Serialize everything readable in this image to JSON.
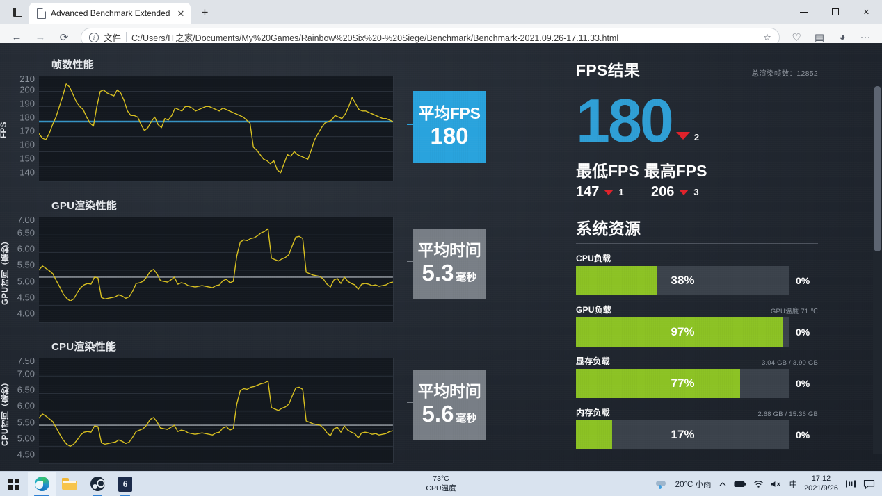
{
  "browser": {
    "tab_title": "Advanced Benchmark Extended",
    "tab_close": "✕",
    "new_tab": "+",
    "back": "←",
    "forward": "→",
    "reload": "⟳",
    "info_glyph": "i",
    "scheme_label": "文件",
    "url": "C:/Users/IT之家/Documents/My%20Games/Rainbow%20Six%20-%20Siege/Benchmark/Benchmark-2021.09.26-17.11.33.html",
    "favorite_star": "☆",
    "favorites_icon": "♡",
    "collections_icon": "▤",
    "profile_icon": "◕",
    "settings_icon": "···",
    "minimize": "—",
    "maximize": "▢",
    "close": "✕"
  },
  "charts": [
    {
      "title": "帧数性能",
      "ylabel": "FPS",
      "badge_top": "平均FPS",
      "badge_top_small": "",
      "badge_value": "180",
      "badge_unit": "",
      "badge_color": "#29a3dd"
    },
    {
      "title": "GPU渲染性能",
      "ylabel": "GPU时间（毫秒）",
      "badge_top": "平均时间",
      "badge_value": "5.3",
      "badge_unit": "毫秒",
      "badge_color": "#787e86"
    },
    {
      "title": "CPU渲染性能",
      "ylabel": "CPU时间（毫秒）",
      "badge_top": "平均时间",
      "badge_value": "5.6",
      "badge_unit": "毫秒",
      "badge_color": "#787e86"
    }
  ],
  "chart_data": [
    {
      "type": "line",
      "title": "帧数性能",
      "xlabel": "",
      "ylabel": "FPS",
      "ylim": [
        140,
        210
      ],
      "yticks": [
        210,
        200,
        190,
        180,
        170,
        160,
        150,
        140
      ],
      "grid": true,
      "line_color": "#d8c020",
      "average_line": {
        "value": 180,
        "color": "#2f9fd6",
        "label": "平均FPS 180"
      },
      "series": [
        {
          "name": "FPS",
          "values": [
            172,
            169,
            168,
            172,
            178,
            183,
            190,
            197,
            205,
            203,
            198,
            193,
            190,
            188,
            183,
            179,
            177,
            190,
            200,
            201,
            199,
            198,
            197,
            201,
            199,
            194,
            187,
            184,
            184,
            183,
            178,
            174,
            176,
            180,
            183,
            178,
            176,
            182,
            181,
            184,
            189,
            188,
            187,
            190,
            190,
            189,
            187,
            188,
            189,
            190,
            190,
            189,
            188,
            187,
            189,
            188,
            187,
            186,
            185,
            184,
            183,
            181,
            179,
            163,
            161,
            158,
            155,
            154,
            152,
            154,
            148,
            146,
            152,
            158,
            157,
            160,
            158,
            157,
            156,
            155,
            161,
            168,
            172,
            176,
            179,
            180,
            181,
            184,
            183,
            182,
            185,
            190,
            196,
            192,
            188,
            187,
            187,
            186,
            185,
            184,
            183,
            182,
            182,
            181,
            180
          ]
        }
      ]
    },
    {
      "type": "line",
      "title": "GPU渲染性能",
      "xlabel": "",
      "ylabel": "GPU时间（毫秒）",
      "ylim": [
        4.0,
        7.0
      ],
      "yticks": [
        "7.00",
        "6.50",
        "6.00",
        "5.50",
        "5.00",
        "4.50",
        "4.00"
      ],
      "grid": true,
      "line_color": "#d8c020",
      "average_line": {
        "value": 5.3,
        "color": "#b9bfc6",
        "label": "平均时间 5.3 毫秒"
      },
      "series": [
        {
          "name": "GPU time (ms)",
          "values": [
            5.5,
            5.62,
            5.55,
            5.48,
            5.4,
            5.2,
            5.02,
            4.82,
            4.7,
            4.62,
            4.68,
            4.85,
            5.0,
            5.08,
            5.12,
            5.1,
            5.3,
            5.28,
            4.72,
            4.68,
            4.7,
            4.72,
            4.74,
            4.8,
            4.76,
            4.7,
            4.74,
            4.9,
            5.12,
            5.14,
            5.18,
            5.3,
            5.46,
            5.52,
            5.4,
            5.2,
            5.18,
            5.16,
            5.22,
            5.3,
            5.1,
            5.14,
            5.12,
            5.06,
            5.04,
            5.02,
            5.04,
            5.06,
            5.04,
            5.02,
            5.0,
            5.06,
            5.08,
            5.2,
            5.24,
            5.14,
            5.18,
            5.9,
            6.3,
            6.36,
            6.34,
            6.4,
            6.42,
            6.48,
            6.56,
            6.6,
            6.68,
            5.84,
            5.8,
            5.76,
            5.82,
            5.86,
            5.94,
            6.2,
            6.44,
            6.46,
            6.4,
            5.44,
            5.4,
            5.36,
            5.34,
            5.32,
            5.24,
            5.1,
            5.02,
            5.22,
            5.26,
            5.12,
            5.3,
            5.18,
            5.12,
            5.08,
            4.96,
            5.1,
            5.12,
            5.1,
            5.06,
            5.08,
            5.04,
            5.06,
            5.08,
            5.14,
            5.16
          ]
        }
      ]
    },
    {
      "type": "line",
      "title": "CPU渲染性能",
      "xlabel": "",
      "ylabel": "CPU时间（毫秒）",
      "ylim": [
        4.5,
        7.5
      ],
      "yticks": [
        "7.50",
        "7.00",
        "6.50",
        "6.00",
        "5.50",
        "5.00",
        "4.50"
      ],
      "grid": true,
      "line_color": "#d8c020",
      "average_line": {
        "value": 5.6,
        "color": "#b9bfc6",
        "label": "平均时间 5.6 毫秒"
      },
      "series": [
        {
          "name": "CPU time (ms)",
          "values": [
            5.8,
            5.92,
            5.86,
            5.78,
            5.7,
            5.52,
            5.34,
            5.18,
            5.06,
            5.0,
            5.06,
            5.18,
            5.32,
            5.4,
            5.42,
            5.4,
            5.58,
            5.56,
            5.1,
            5.06,
            5.08,
            5.1,
            5.12,
            5.18,
            5.14,
            5.08,
            5.12,
            5.26,
            5.42,
            5.46,
            5.5,
            5.6,
            5.76,
            5.82,
            5.7,
            5.52,
            5.5,
            5.48,
            5.54,
            5.6,
            5.42,
            5.46,
            5.44,
            5.38,
            5.36,
            5.34,
            5.36,
            5.38,
            5.36,
            5.34,
            5.32,
            5.38,
            5.4,
            5.52,
            5.56,
            5.46,
            5.5,
            6.2,
            6.58,
            6.64,
            6.62,
            6.68,
            6.7,
            6.74,
            6.78,
            6.8,
            6.86,
            6.1,
            6.06,
            6.02,
            6.08,
            6.12,
            6.2,
            6.44,
            6.66,
            6.68,
            6.62,
            5.72,
            5.68,
            5.64,
            5.62,
            5.6,
            5.52,
            5.38,
            5.3,
            5.5,
            5.54,
            5.4,
            5.58,
            5.46,
            5.4,
            5.36,
            5.24,
            5.38,
            5.4,
            5.38,
            5.34,
            5.36,
            5.32,
            5.34,
            5.36,
            5.42,
            5.44
          ]
        }
      ]
    }
  ],
  "results": {
    "fps_section_title": "FPS结果",
    "total_frames_label": "总渲染帧数：12852",
    "avg_fps": "180",
    "avg_fps_rank": "2",
    "min_label": "最低FPS",
    "max_label": "最高FPS",
    "min_value": "147",
    "min_rank": "1",
    "max_value": "206",
    "max_rank": "3",
    "resources_title": "系统资源",
    "rows": [
      {
        "label": "CPU负载",
        "note": "",
        "value": "38%",
        "percent": 38,
        "right": "0%"
      },
      {
        "label": "GPU负载",
        "note": "GPU温度 71 ℃",
        "value": "97%",
        "percent": 97,
        "right": "0%"
      },
      {
        "label": "显存负载",
        "note": "3.04 GB / 3.90 GB",
        "value": "77%",
        "percent": 77,
        "right": "0%"
      },
      {
        "label": "内存负载",
        "note": "2.68 GB / 15.36 GB",
        "value": "17%",
        "percent": 17,
        "right": "0%"
      }
    ]
  },
  "taskbar": {
    "cpu_temp": "73°C",
    "cpu_temp_label": "CPU温度",
    "weather": "20°C 小雨",
    "chevron": "︿",
    "ime": "中",
    "time": "17:12",
    "date": "2021/9/26",
    "mute_icon": "🔇",
    "wifi_icon": "",
    "battery_icon": "",
    "taskview_icon": "▭",
    "chat_icon": "▭"
  }
}
